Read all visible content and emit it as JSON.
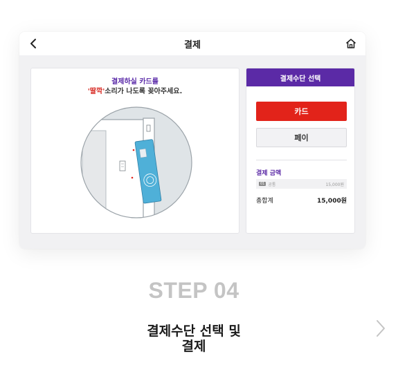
{
  "topbar": {
    "title": "결제"
  },
  "instructions": {
    "line1": "결제하실 카드를",
    "line2_emphasis": "'딸깍'",
    "line2_rest": "소리가 나도록 꽂아주세요."
  },
  "payment_panel": {
    "header": "결제수단 선택",
    "card_button": "카드",
    "pay_button": "페이",
    "amount_title": "결제 금액",
    "amount_row": {
      "tag": "01",
      "label": "공통",
      "value": "15,000원"
    },
    "total_label": "총합계",
    "total_value": "15,000원"
  },
  "step": {
    "label": "STEP 04",
    "caption_line1": "결제수단 선택 및",
    "caption_line2": "결제"
  },
  "colors": {
    "accent_purple": "#5b2aa6",
    "card_red": "#e2231a",
    "card_blue": "#4fb0d8"
  },
  "icons": {
    "back": "chevron-left-icon",
    "home": "home-icon",
    "next": "chevron-right-icon"
  }
}
